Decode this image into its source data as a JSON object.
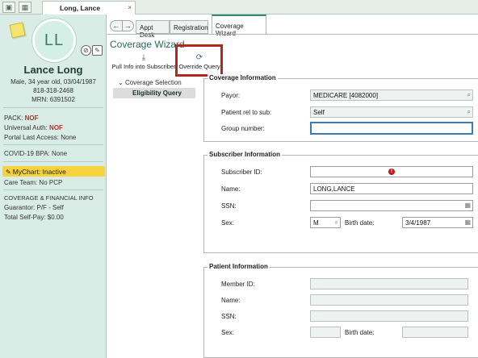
{
  "app": {
    "patient_tab": "Long, Lance",
    "tab_close": "×"
  },
  "patient": {
    "initials": "LL",
    "name": "Lance Long",
    "demographics": "Male, 34 year old, 03/04/1987",
    "phone": "818-318-2468",
    "mrn": "MRN: 6391502",
    "pack_label": "PACK:",
    "pack_value": "NOF",
    "universal_auth_label": "Universal Auth:",
    "universal_auth_value": "NOF",
    "portal_access": "Portal Last Access: None",
    "covid": "COVID-19 BPA: None",
    "mychart": "MyChart: Inactive",
    "care_team": "Care Team: No PCP",
    "coverage_header": "COVERAGE & FINANCIAL INFO",
    "guarantor": "Guarantor: P/F - Self",
    "self_pay": "Total Self-Pay: $0.00"
  },
  "activity_tabs": [
    "Appt Desk",
    "Registration",
    "Coverage Wizard"
  ],
  "wizard": {
    "title": "Coverage Wizard",
    "toolbar": {
      "pull_info": "Pull Info into Subscriber",
      "override_query": "Override Query"
    },
    "steps": {
      "coverage_selection": "Coverage Selection",
      "eligibility_query": "Eligibility Query"
    }
  },
  "coverage_info": {
    "title": "Coverage Information",
    "payor_label": "Payor:",
    "payor_value": "MEDICARE [4082000]",
    "rel_label": "Patient rel to sub:",
    "rel_value": "Self",
    "group_label": "Group number:",
    "group_value": ""
  },
  "subscriber_info": {
    "title": "Subscriber Information",
    "id_label": "Subscriber ID:",
    "id_value": "",
    "name_label": "Name:",
    "name_value": "LONG,LANCE",
    "ssn_label": "SSN:",
    "ssn_value": "",
    "sex_label": "Sex:",
    "sex_value": "M",
    "birth_label": "Birth date:",
    "birth_value": "3/4/1987"
  },
  "patient_info": {
    "title": "Patient Information",
    "member_label": "Member ID:",
    "member_value": "",
    "name_label": "Name:",
    "name_value": "",
    "ssn_label": "SSN:",
    "ssn_value": "",
    "sex_label": "Sex:",
    "sex_value": "",
    "birth_label": "Birth date:",
    "birth_value": ""
  },
  "colors": {
    "accent": "#2f8a6e",
    "sidebar": "#d9ece6",
    "alert_red": "#c0291e",
    "mychart_yellow": "#f6d23c",
    "highlight_box": "#b5271d"
  }
}
